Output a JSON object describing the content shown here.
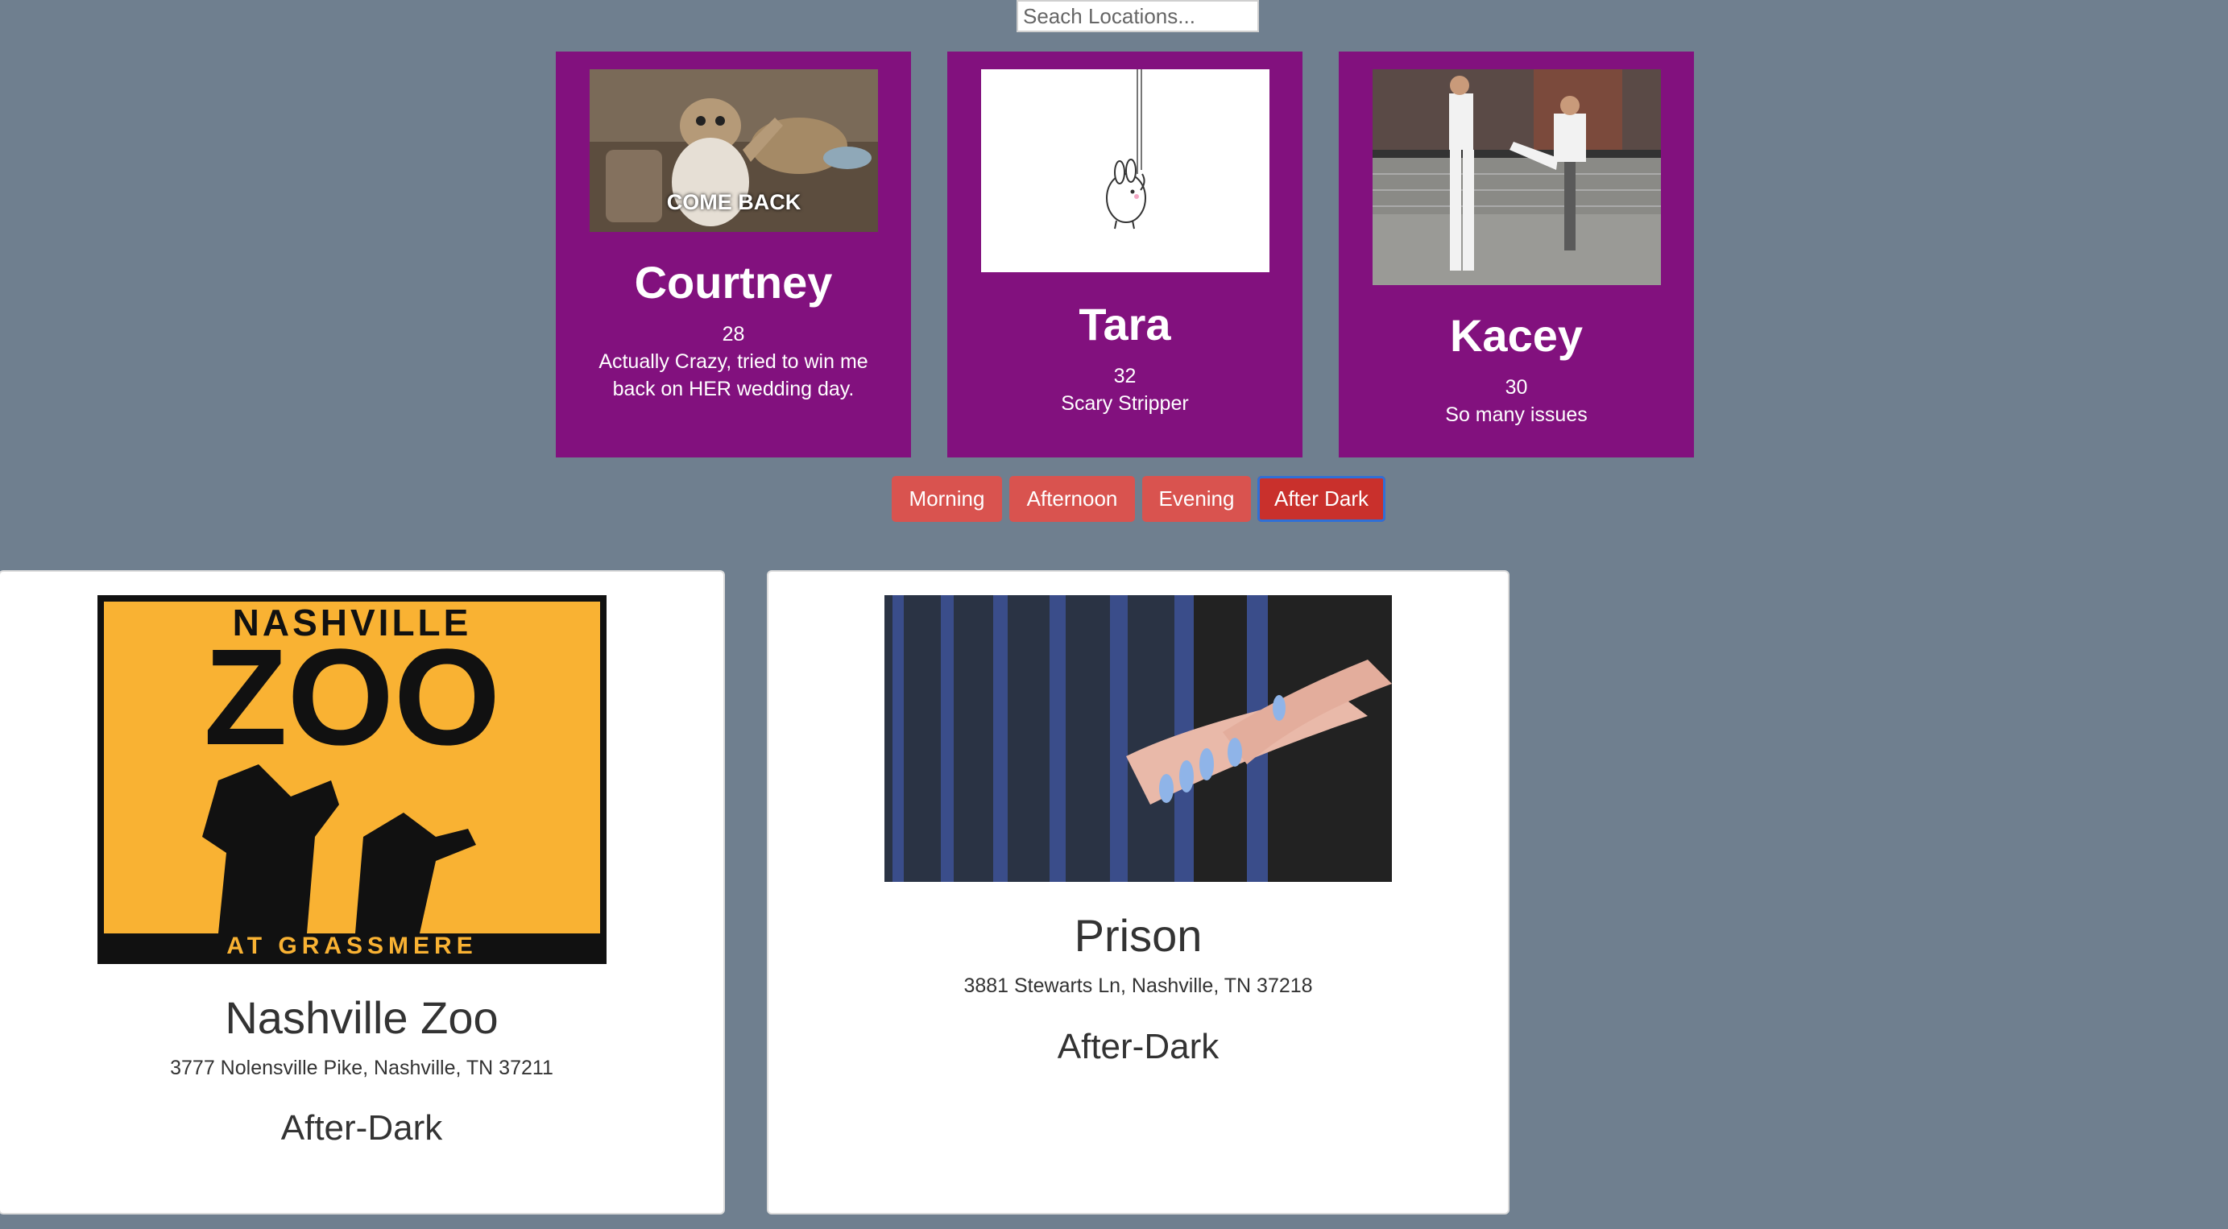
{
  "search": {
    "placeholder": "Seach Locations..."
  },
  "people": [
    {
      "name": "Courtney",
      "age": "28",
      "description": "Actually Crazy, tried to win me back on HER wedding day.",
      "image_caption": "COME BACK"
    },
    {
      "name": "Tara",
      "age": "32",
      "description": "Scary Stripper"
    },
    {
      "name": "Kacey",
      "age": "30",
      "description": "So many issues"
    }
  ],
  "time_filters": {
    "buttons": [
      "Morning",
      "Afternoon",
      "Evening",
      "After Dark"
    ],
    "active": "After Dark"
  },
  "locations": [
    {
      "name": "Nashville Zoo",
      "address": "3777 Nolensville Pike, Nashville, TN 37211",
      "time": "After-Dark",
      "logo": {
        "top_text": "NASHVILLE",
        "big_text": "ZOO",
        "bottom_text": "AT GRASSMERE"
      }
    },
    {
      "name": "Prison",
      "address": "3881 Stewarts Ln, Nashville, TN 37218",
      "time": "After-Dark"
    }
  ],
  "colors": {
    "page_bg": "#6f7f8f",
    "card_purple": "#82117e",
    "button_red": "#d9534f",
    "button_active": "#c9302c",
    "zoo_orange": "#f9b233"
  }
}
